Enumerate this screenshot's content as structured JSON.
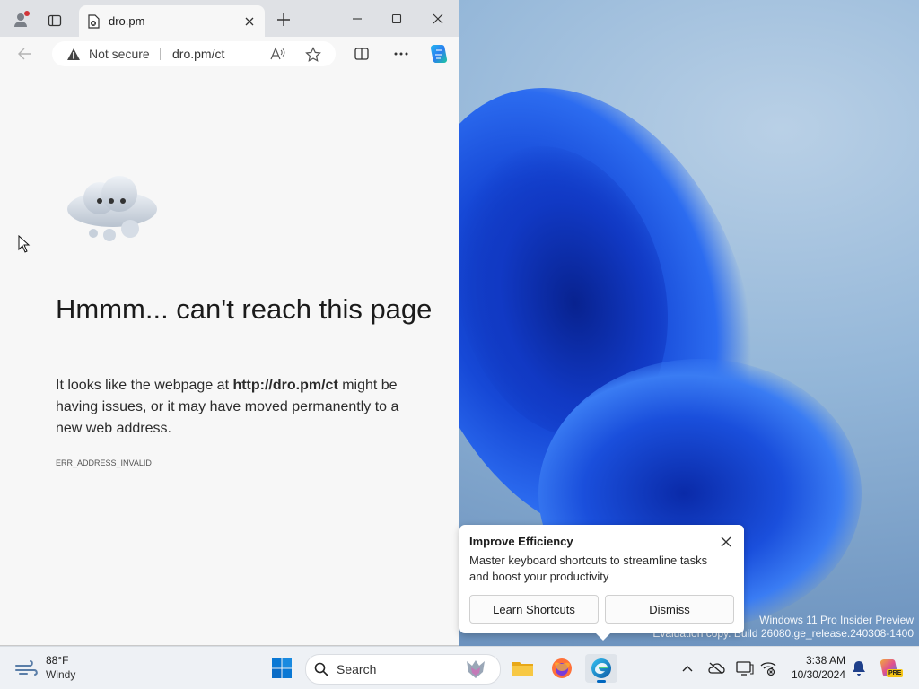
{
  "browser": {
    "tab_title": "dro.pm",
    "security_label": "Not secure",
    "url": "dro.pm/ct"
  },
  "error_page": {
    "title": "Hmmm... can't reach this page",
    "body_prefix": "It looks like the webpage at ",
    "body_url": "http://dro.pm/ct",
    "body_suffix": " might be having issues, or it may have moved permanently to a new web address.",
    "error_code": "ERR_ADDRESS_INVALID"
  },
  "toast": {
    "title": "Improve Efficiency",
    "body": "Master keyboard shortcuts to streamline tasks and boost your productivity",
    "primary_label": "Learn Shortcuts",
    "secondary_label": "Dismiss"
  },
  "desktop": {
    "watermark_line1": "Windows 11 Pro Insider Preview",
    "watermark_line2": "Evaluation copy. Build 26080.ge_release.240308-1400"
  },
  "taskbar": {
    "weather_temp": "88°F",
    "weather_desc": "Windy",
    "search_placeholder": "Search",
    "time": "3:38 AM",
    "date": "10/30/2024",
    "copilot_badge": "PRE"
  },
  "colors": {
    "accent": "#0067c0",
    "tabbar_bg": "#dfe1e5",
    "page_bg": "#f7f7f7",
    "taskbar_bg": "#eef1f5"
  },
  "icons": [
    "profile-icon",
    "workspaces-icon",
    "site-warning-icon",
    "tab-close-icon",
    "new-tab-icon",
    "minimize-icon",
    "maximize-icon",
    "window-close-icon",
    "back-icon",
    "warning-icon",
    "read-aloud-icon",
    "favorite-icon",
    "split-screen-icon",
    "more-icon",
    "copilot-icon",
    "cloud-error-icon",
    "toast-close-icon",
    "weather-wind-icon",
    "start-icon",
    "search-icon",
    "search-highlight-icon",
    "file-explorer-icon",
    "firefox-icon",
    "edge-icon",
    "chevron-up-icon",
    "onedrive-offline-icon",
    "display-icon",
    "network-off-icon",
    "notification-bell-icon",
    "copilot-taskbar-icon"
  ]
}
